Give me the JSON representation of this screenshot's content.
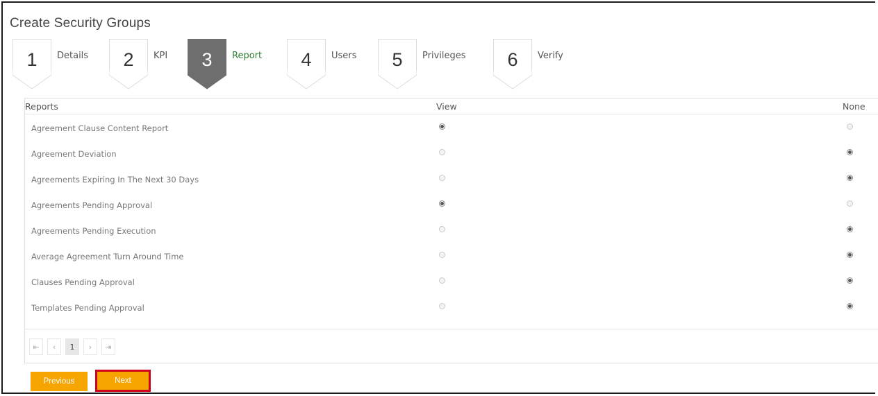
{
  "page": {
    "title": "Create Security Groups"
  },
  "steps": [
    {
      "number": "1",
      "label": "Details",
      "active": false
    },
    {
      "number": "2",
      "label": "KPI",
      "active": false
    },
    {
      "number": "3",
      "label": "Report",
      "active": true
    },
    {
      "number": "4",
      "label": "Users",
      "active": false
    },
    {
      "number": "5",
      "label": "Privileges",
      "active": false
    },
    {
      "number": "6",
      "label": "Verify",
      "active": false
    }
  ],
  "grid": {
    "columns": {
      "reports": "Reports",
      "view": "View",
      "none": "None"
    },
    "rows": [
      {
        "name": "Agreement Clause Content Report",
        "selected": "view"
      },
      {
        "name": "Agreement Deviation",
        "selected": "none"
      },
      {
        "name": "Agreements Expiring In The Next 30 Days",
        "selected": "none"
      },
      {
        "name": "Agreements Pending Approval",
        "selected": "view"
      },
      {
        "name": "Agreements Pending Execution",
        "selected": "none"
      },
      {
        "name": "Average Agreement Turn Around Time",
        "selected": "none"
      },
      {
        "name": "Clauses Pending Approval",
        "selected": "none"
      },
      {
        "name": "Templates Pending Approval",
        "selected": "none"
      }
    ]
  },
  "pager": {
    "first": "⇤",
    "prev": "‹",
    "current": "1",
    "next": "›",
    "last": "⇥"
  },
  "buttons": {
    "previous": "Previous",
    "next": "Next"
  },
  "colors": {
    "accent": "#f5a400",
    "active_step": "#6e6e6e",
    "active_label": "#2e7d32",
    "highlight": "#d0021b"
  }
}
